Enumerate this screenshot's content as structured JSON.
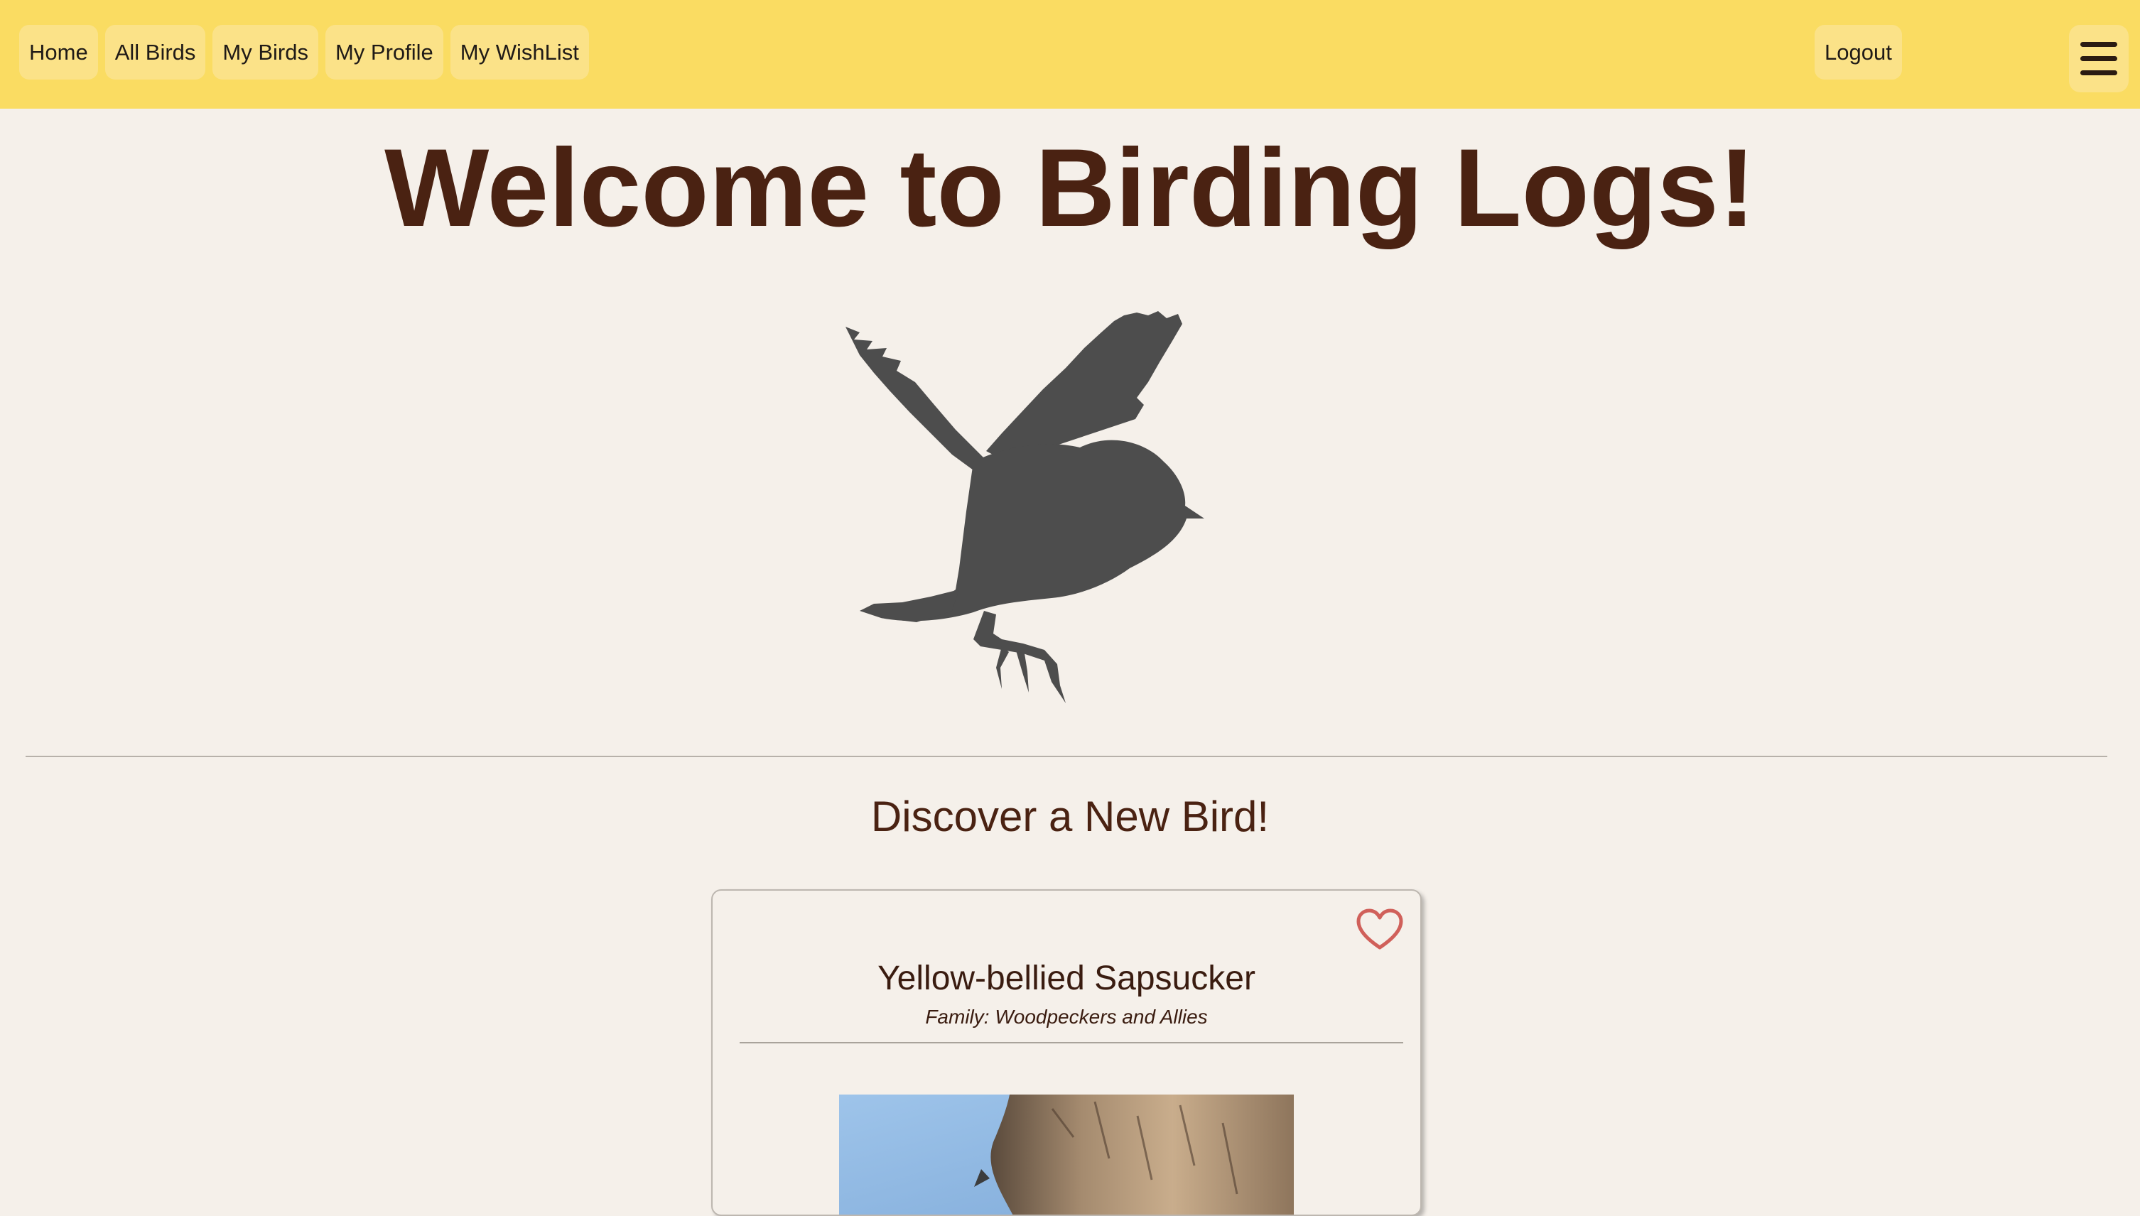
{
  "nav": {
    "items": [
      {
        "label": "Home"
      },
      {
        "label": "All Birds"
      },
      {
        "label": "My Birds"
      },
      {
        "label": "My Profile"
      },
      {
        "label": "My WishList"
      }
    ],
    "logout_label": "Logout",
    "menu_icon": "hamburger-menu-icon"
  },
  "hero": {
    "title": "Welcome to Birding Logs!",
    "image_icon": "bird-silhouette-icon"
  },
  "discover": {
    "title": "Discover a New Bird!",
    "card": {
      "bird_name": "Yellow-bellied Sapsucker",
      "family": "Family: Woodpeckers and Allies",
      "favorite_icon": "heart-outline-icon"
    }
  },
  "colors": {
    "navbar": "#fadc62",
    "nav_button": "#fbe288",
    "background": "#f5f0ea",
    "title_brown": "#4a2212",
    "heart_red": "#d0605a",
    "silhouette": "#4d4d4d"
  }
}
